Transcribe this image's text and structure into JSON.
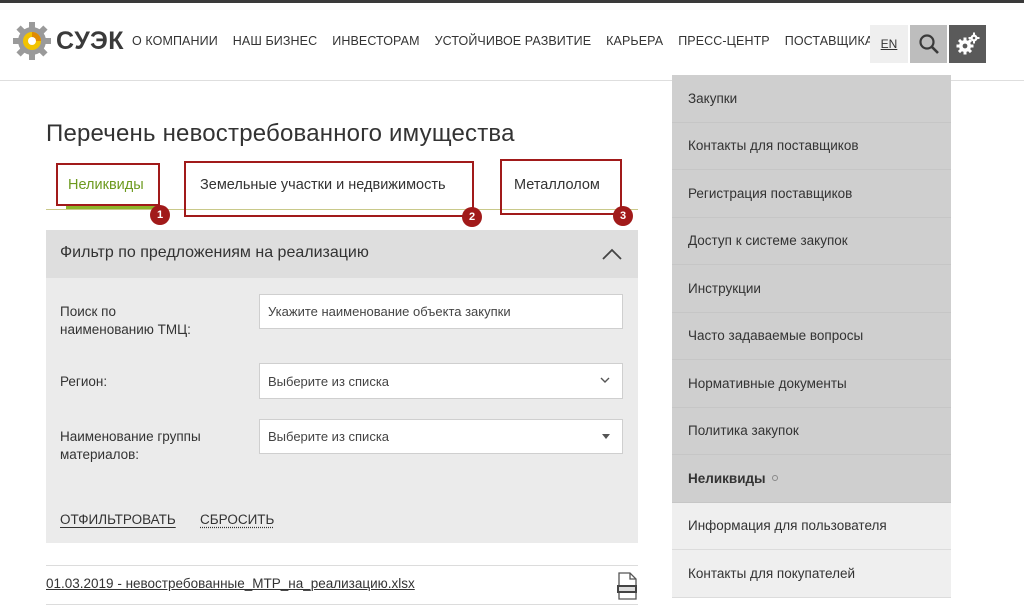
{
  "header": {
    "logo_text": "СУЭК",
    "nav": [
      {
        "label": "О КОМПАНИИ"
      },
      {
        "label": "НАШ БИЗНЕС"
      },
      {
        "label": "ИНВЕСТОРАМ"
      },
      {
        "label": "УСТОЙЧИВОЕ РАЗВИТИЕ"
      },
      {
        "label": "КАРЬЕРА"
      },
      {
        "label": "ПРЕСС-ЦЕНТР"
      },
      {
        "label": "ПОСТАВЩИКАМ"
      }
    ],
    "lang_label": "EN",
    "accent_color": "#8db42b"
  },
  "main": {
    "title": "Перечень невостребованного имущества",
    "tabs": [
      {
        "label": "Неликвиды",
        "badge": "1"
      },
      {
        "label": "Земельные участки и недвижимость",
        "badge": "2"
      },
      {
        "label": "Металлолом",
        "badge": "3"
      }
    ],
    "filter": {
      "title": "Фильтр по предложениям на реализацию",
      "search_label_1": "Поиск по",
      "search_label_2": "наименованию ТМЦ:",
      "search_placeholder": "Укажите наименование объекта закупки",
      "region_label": "Регион:",
      "region_value": "Выберите из списка",
      "group_label_1": "Наименование группы",
      "group_label_2": "материалов:",
      "group_value": "Выберите из списка",
      "apply_label": "ОТФИЛЬТРОВАТЬ",
      "reset_label": "СБРОСИТЬ"
    },
    "file": {
      "name": "01.03.2019 - невостребованные_МТР_на_реализацию.xlsx"
    },
    "callout_color": "#a11a1a"
  },
  "sidebar": {
    "items": [
      {
        "label": "Закупки"
      },
      {
        "label": "Контакты для поставщиков"
      },
      {
        "label": "Регистрация поставщиков"
      },
      {
        "label": "Доступ к системе закупок"
      },
      {
        "label": "Инструкции"
      },
      {
        "label": "Часто задаваемые вопросы"
      },
      {
        "label": "Нормативные документы"
      },
      {
        "label": "Политика закупок"
      },
      {
        "label": "Неликвиды"
      },
      {
        "label": "Информация для пользователя"
      },
      {
        "label": "Контакты для покупателей"
      }
    ]
  }
}
